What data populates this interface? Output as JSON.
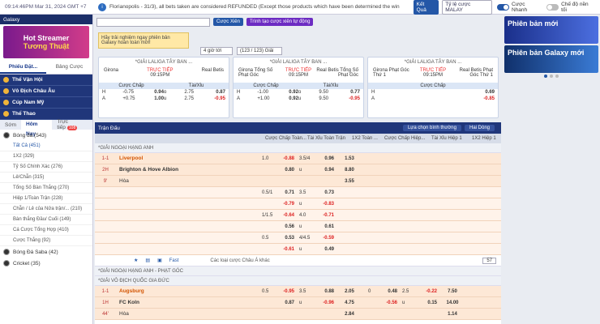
{
  "topbar": {
    "clock": "09:14:46PM Mar 31, 2024 GMT +7",
    "ticker": "Florianopolis - 31/3), all bets taken are considered REFUNDED (Except those products which have been determined the win",
    "result_btn": "Kết Quả",
    "odds_type": "Tỷ lệ cược MALAY",
    "quick_bet": "Cược Nhanh",
    "night_mode": "Chế độ nền tối"
  },
  "sidebar": {
    "header": "Galaxy",
    "promo_line1": "Hot Streamer",
    "promo_line2": "Tương Thuật",
    "tabs": [
      "Phiếu Đặt...",
      "Bảng Cược"
    ],
    "sections": [
      "Thể Vận Hội",
      "Vô Địch Châu Âu",
      "Cúp Nam Mỹ",
      "Thể Thao"
    ],
    "subtabs": [
      "Sớm",
      "Hôm Nay",
      "Trực tiếp"
    ],
    "live_count": "108",
    "sport": "Bóng đá",
    "sport_count": "(543)",
    "items": [
      "Tất Cả (451)",
      "1X2 (329)",
      "Tỷ Số Chính Xác (276)",
      "Lẻ/Chẵn (315)",
      "Tổng Số Bàn Thắng (270)",
      "Hiệp 1/Toàn Trận (228)",
      "Chẵn / Lẻ của Nửa trận/...  (210)",
      "Bàn thắng Đầu/ Cuối (149)",
      "Cá Cược Tổng Hợp (410)",
      "Cược Thắng (92)"
    ],
    "other_sports": [
      "Bóng Đá Saba",
      "(42)",
      "Cricket",
      "(35)"
    ]
  },
  "filters": {
    "search_placeholder": "",
    "btn_search": "Cược Xiên",
    "btn_create": "Trình tạo cược xiên tự động",
    "tooltip": "Hãy trải nghiệm ngay phiên bản Galaxy hoàn toàn mới!",
    "time_select": "4 giờ tới",
    "count_select": "(123 / 123) Giải"
  },
  "cards": [
    {
      "league": "*GIẢI LALIGA TÂY BAN ...",
      "home": "Girona",
      "away": "Real Betis",
      "status": "TRỰC TIẾP",
      "time": "09:15PM",
      "h1": "Cược Chấp",
      "h2": "Tài/Xỉu",
      "rows": [
        [
          "H",
          "-0.75",
          "0.94",
          "o",
          "2.75",
          "0.87"
        ],
        [
          "A",
          "+0.75",
          "1.00",
          "u",
          "2.75",
          "-0.95"
        ]
      ]
    },
    {
      "league": "*GIẢI LALIGA TÂY BAN ...",
      "home": "Girona Tổng Số Phạt Góc",
      "away": "Real Betis Tổng Số Phạt Góc",
      "status": "TRỰC TIẾP",
      "time": "09:15PM",
      "h1": "Cược Chấp",
      "h2": "Tài/Xỉu",
      "rows": [
        [
          "H",
          "-1.00",
          "0.92",
          "o",
          "9.50",
          "0.77"
        ],
        [
          "A",
          "+1.00",
          "0.92",
          "u",
          "9.50",
          "-0.95"
        ]
      ]
    },
    {
      "league": "*GIẢI LALIGA TÂY BAN ...",
      "home": "Girona Phạt Góc Thứ 1",
      "away": "Real Betis Phạt Góc Thứ 1",
      "status": "TRỰC TIẾP",
      "time": "09:15PM",
      "h1": "Cược Chấp",
      "h2": "",
      "rows": [
        [
          "H",
          "",
          "0.69",
          "",
          "",
          ""
        ],
        [
          "A",
          "",
          "-0.85",
          "",
          "",
          ""
        ]
      ]
    }
  ],
  "table": {
    "title": "Trận Đấu",
    "sort": "Lựa chọn bình thường",
    "view": "Hai Dòng",
    "columns": [
      "Cược Chấp Toàn...",
      "Tài Xỉu Toàn Trận",
      "1X2 Toàn ...",
      "Cược Chấp Hiệp...",
      "Tài Xỉu Hiệp 1",
      "1X2 Hiệp 1"
    ],
    "league1": "*GIẢI NGOẠI HẠNG ANH",
    "match1": {
      "score": "1-1",
      "period": "2H",
      "minute": "9'",
      "home": "Liverpool",
      "away": "Brighton & Hove Albion",
      "draw": "Hòa",
      "lines": [
        [
          "1.0",
          "-0.88",
          "3.5/4",
          "0.96",
          "1.53"
        ],
        [
          "",
          "0.80",
          "u",
          "0.94",
          "8.80"
        ],
        [
          "",
          "",
          "",
          "",
          "3.55"
        ],
        [
          "0.5/1",
          "0.71",
          "3.5",
          "0.73",
          ""
        ],
        [
          "",
          "-0.79",
          "u",
          "-0.83",
          ""
        ],
        [
          "1/1.5",
          "-0.64",
          "4.0",
          "-0.71",
          ""
        ],
        [
          "",
          "0.56",
          "u",
          "0.61",
          ""
        ],
        [
          "0.5",
          "0.53",
          "4/4.5",
          "-0.59",
          ""
        ],
        [
          "",
          "-0.61",
          "u",
          "0.49",
          ""
        ]
      ]
    },
    "more_bets": "Các loại cược Châu Á khác",
    "fast": "Fast",
    "page_count": "57",
    "league2": "*GIẢI NGOẠI HẠNG ANH - PHẠT GÓC",
    "league3": "*GIẢI VÔ ĐỊCH QUỐC GIA ĐỨC",
    "match2": {
      "score": "1-1",
      "period": "1H",
      "minute": "44'",
      "home": "Augsburg",
      "away": "FC Koln",
      "draw": "Hòa",
      "lines": [
        [
          "0.5",
          "-0.95",
          "3.5",
          "0.88",
          "2.05",
          "0",
          "0.48",
          "2.5",
          "-0.22",
          "7.50"
        ],
        [
          "",
          "0.87",
          "u",
          "-0.96",
          "4.75",
          "",
          "-0.56",
          "u",
          "0.15",
          "14.00"
        ],
        [
          "",
          "",
          "",
          "",
          "2.84",
          "",
          "",
          "",
          "",
          "1.14"
        ]
      ]
    }
  },
  "right": {
    "banner1": "Phiên bản mới",
    "banner2": "Phiên bản Galaxy mới"
  }
}
